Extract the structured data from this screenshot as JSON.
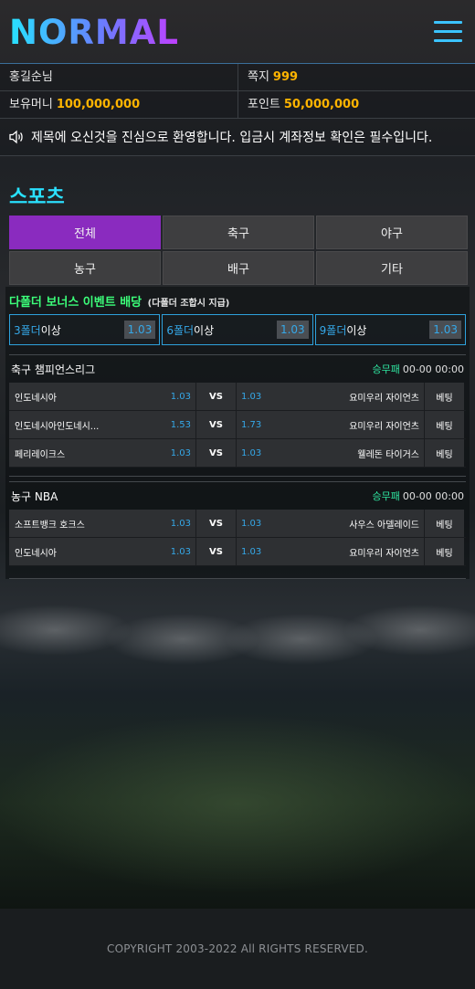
{
  "header": {
    "logo": "NORMAL",
    "menu_icon": "hamburger-menu-icon"
  },
  "user": {
    "name": "홍길순님",
    "message_label": "쪽지",
    "message_count": "999",
    "money_label": "보유머니",
    "money_value": "100,000,000",
    "point_label": "포인트",
    "point_value": "50,000,000"
  },
  "notice": {
    "icon": "speaker-icon",
    "text": "제목에 오신것을 진심으로 환영합니다. 입금시 계좌정보 확인은 필수입니다."
  },
  "section_title": "스포츠",
  "tabs": [
    {
      "label": "전체",
      "active": true
    },
    {
      "label": "축구"
    },
    {
      "label": "야구"
    },
    {
      "label": "농구"
    },
    {
      "label": "배구"
    },
    {
      "label": "기타"
    }
  ],
  "bonus": {
    "title": "다폴더 보너스 이벤트 배당",
    "subtitle": "(다폴더 조합시 지급)",
    "items": [
      {
        "count": "3폴더",
        "suffix": "이상",
        "odds": "1.03"
      },
      {
        "count": "6폴더",
        "suffix": "이상",
        "odds": "1.03"
      },
      {
        "count": "9폴더",
        "suffix": "이상",
        "odds": "1.03"
      }
    ]
  },
  "leagues": [
    {
      "name": "축구 챔피언스리그",
      "type": "승무패",
      "time": "00-00 00:00",
      "matches": [
        {
          "home": "인도네시아",
          "home_odds": "1.03",
          "vs": "VS",
          "away_odds": "1.03",
          "away": "요미우리 자이언츠",
          "bet": "베팅"
        },
        {
          "home": "인도네시아인도네시...",
          "home_odds": "1.53",
          "vs": "VS",
          "away_odds": "1.73",
          "away": "요미우리 자이언츠",
          "bet": "베팅"
        },
        {
          "home": "페리레이크스",
          "home_odds": "1.03",
          "vs": "VS",
          "away_odds": "1.03",
          "away": "웰레돈 타이거스",
          "bet": "베팅"
        }
      ]
    },
    {
      "name": "농구 NBA",
      "type": "승무패",
      "time": "00-00 00:00",
      "matches": [
        {
          "home": "소프트뱅크 호크스",
          "home_odds": "1.03",
          "vs": "VS",
          "away_odds": "1.03",
          "away": "사우스 아델레이드",
          "bet": "베팅"
        },
        {
          "home": "인도네시아",
          "home_odds": "1.03",
          "vs": "VS",
          "away_odds": "1.03",
          "away": "요미우리 자이언츠",
          "bet": "베팅"
        }
      ]
    }
  ],
  "footer": {
    "copyright": "COPYRIGHT 2003-2022 All RIGHTS RESERVED."
  }
}
